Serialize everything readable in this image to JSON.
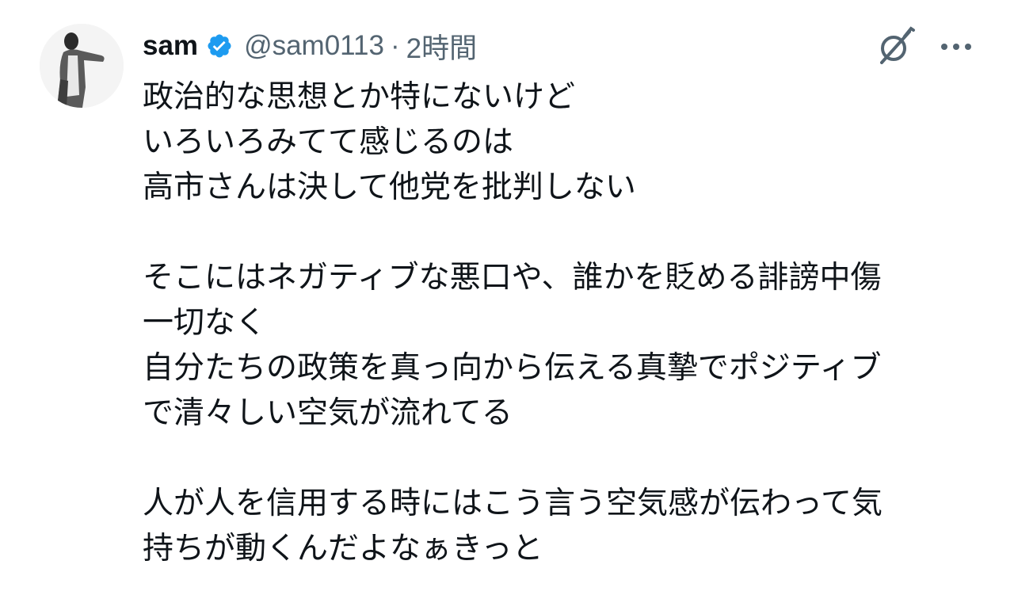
{
  "author": {
    "display_name": "sam",
    "handle": "@sam0113",
    "separator": "·",
    "timestamp": "2時間",
    "verified": true
  },
  "icons": {
    "avatar": "avatar-photo",
    "verified": "verified-badge-icon",
    "grok": "grok-icon",
    "more": "more-options-icon"
  },
  "colors": {
    "verified_badge": "#1d9bf0",
    "text": "#0f1419",
    "secondary_text": "#536471"
  },
  "tweet": {
    "lines": [
      "政治的な思想とか特にないけど",
      "いろいろみてて感じるのは",
      "高市さんは決して他党を批判しない",
      "",
      "そこにはネガティブな悪口や、誰かを貶める誹謗中傷",
      "一切なく",
      "自分たちの政策を真っ向から伝える真摯でポジティブ",
      "で清々しい空気が流れてる",
      "",
      "人が人を信用する時にはこう言う空気感が伝わって気",
      "持ちが動くんだよなぁきっと"
    ]
  }
}
